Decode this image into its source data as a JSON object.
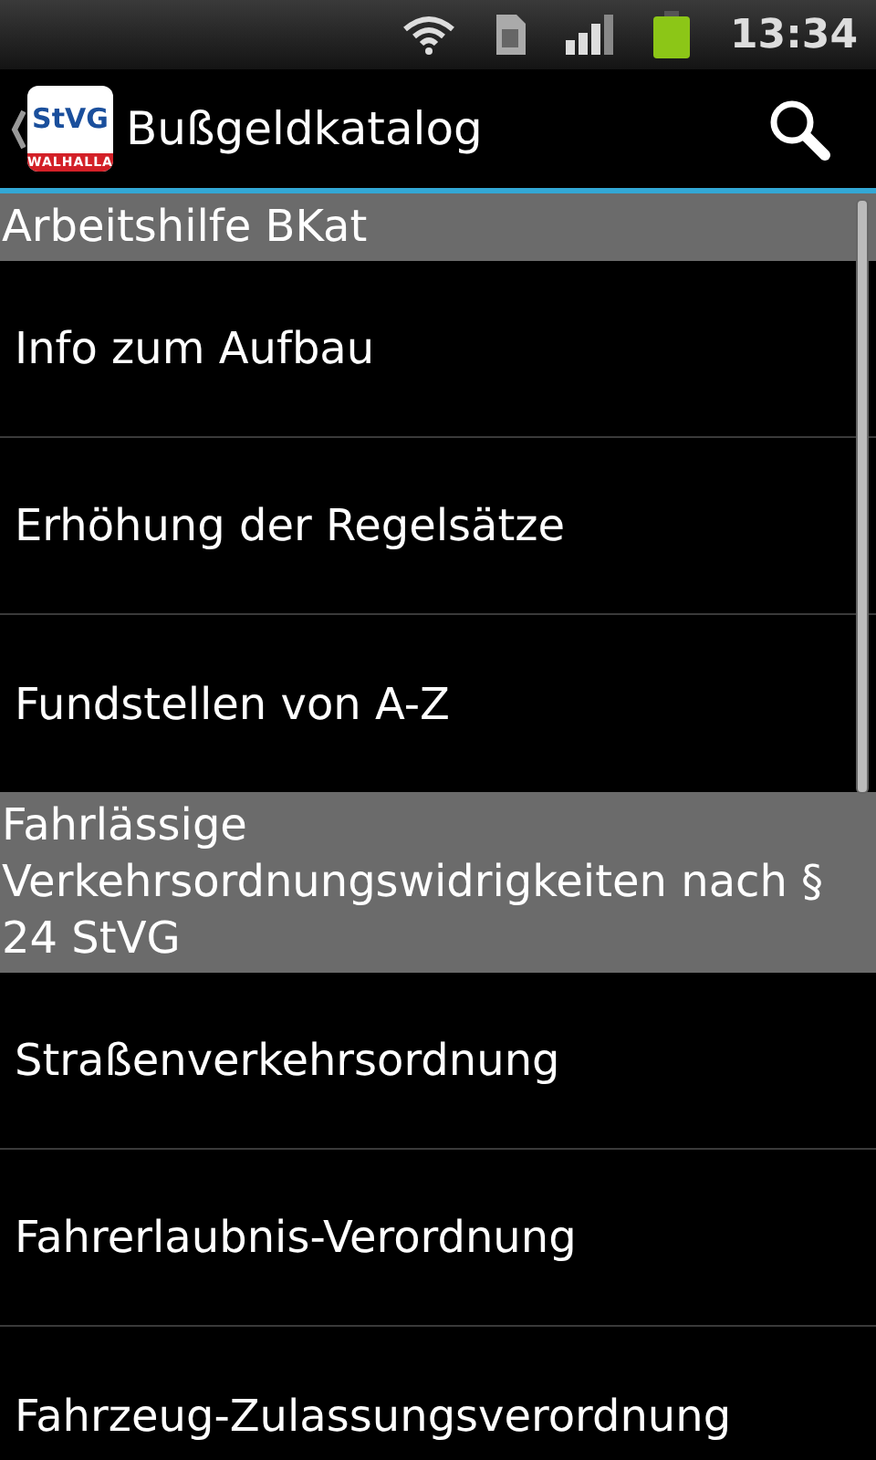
{
  "status_bar": {
    "time": "13:34"
  },
  "action_bar": {
    "logo_text": "StVG",
    "logo_subtext": "WALHALLA",
    "title": "Bußgeldkatalog"
  },
  "sections": [
    {
      "title": "Arbeitshilfe BKat",
      "items": [
        {
          "label": "Info zum Aufbau"
        },
        {
          "label": "Erhöhung der Regelsätze"
        },
        {
          "label": "Fundstellen von A-Z"
        }
      ]
    },
    {
      "title": "Fahrlässige Verkehrsordnungswidrigkeiten nach § 24 StVG",
      "items": [
        {
          "label": "Straßenverkehrsordnung"
        },
        {
          "label": "Fahrerlaubnis-Verordnung"
        },
        {
          "label": "Fahrzeug-Zulassungsverordnung"
        }
      ]
    }
  ]
}
